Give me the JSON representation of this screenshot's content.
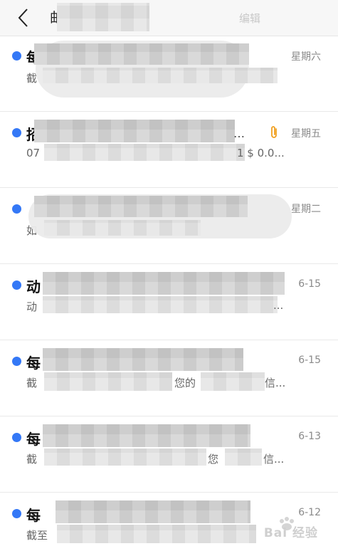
{
  "header": {
    "title_visible": "邮",
    "action_label": "编辑"
  },
  "messages": [
    {
      "subject_visible": "每",
      "preview_visible": "截",
      "date": "星期六",
      "unread": true,
      "has_attachment": false,
      "extra": []
    },
    {
      "subject_visible": "招",
      "preview_visible": "07",
      "date": "星期五",
      "unread": true,
      "has_attachment": true,
      "extra": [
        "1 $ 0.0..."
      ]
    },
    {
      "subject_visible": "",
      "preview_visible": "如",
      "date": "星期二",
      "unread": true,
      "has_attachment": false,
      "extra": []
    },
    {
      "subject_visible": "动",
      "preview_visible": "动",
      "date": "6-15",
      "unread": true,
      "has_attachment": false,
      "extra": [
        "..."
      ]
    },
    {
      "subject_visible": "每",
      "preview_visible": "截",
      "date": "6-15",
      "unread": true,
      "has_attachment": false,
      "extra": [
        "您的",
        "信..."
      ]
    },
    {
      "subject_visible": "每",
      "preview_visible": "截",
      "date": "6-13",
      "unread": true,
      "has_attachment": false,
      "extra": [
        "您",
        "信..."
      ]
    },
    {
      "subject_visible": "每",
      "preview_visible": "截至",
      "date": "6-12",
      "unread": true,
      "has_attachment": false,
      "extra": []
    }
  ],
  "colors": {
    "accent": "#3478f6",
    "attachment": "#f0a020"
  },
  "watermark": "Bai 经验"
}
